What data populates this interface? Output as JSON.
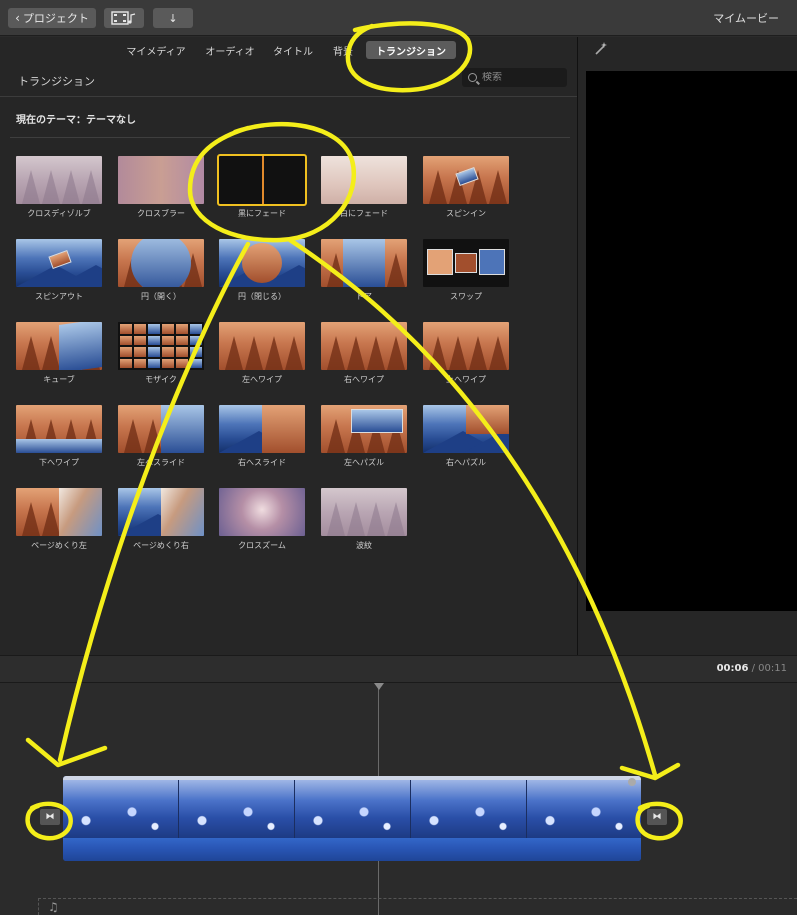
{
  "toolbar": {
    "back_label": "プロジェクト",
    "back_chevron": "‹",
    "media_icon": "film-music-icon",
    "import_icon": "download-arrow-icon",
    "import_glyph": "↓",
    "project_title": "マイムービー"
  },
  "browser": {
    "tabs": [
      {
        "label": "マイメディア",
        "active": false
      },
      {
        "label": "オーディオ",
        "active": false
      },
      {
        "label": "タイトル",
        "active": false
      },
      {
        "label": "背景",
        "active": false
      },
      {
        "label": "トランジション",
        "active": true
      }
    ],
    "panel_title": "トランジション",
    "search_placeholder": "検索",
    "theme_label": "現在のテーマ：テーマなし",
    "transitions": [
      {
        "label": "クロスディゾルブ",
        "style": "pale"
      },
      {
        "label": "クロスブラー",
        "style": "blur"
      },
      {
        "label": "黒にフェード",
        "style": "dark",
        "selected": true
      },
      {
        "label": "白にフェード",
        "style": "lightfade"
      },
      {
        "label": "スピンイン",
        "style": "forest"
      },
      {
        "label": "スピンアウト",
        "style": "mountain"
      },
      {
        "label": "円（開く）",
        "style": "forest"
      },
      {
        "label": "円（閉じる）",
        "style": "mountain"
      },
      {
        "label": "ドア",
        "style": "forest"
      },
      {
        "label": "スワップ",
        "style": "dark"
      },
      {
        "label": "キューブ",
        "style": "forest"
      },
      {
        "label": "モザイク",
        "style": "dark"
      },
      {
        "label": "左へワイプ",
        "style": "forest"
      },
      {
        "label": "右へワイプ",
        "style": "forest"
      },
      {
        "label": "上へワイプ",
        "style": "forest"
      },
      {
        "label": "下へワイプ",
        "style": "forest"
      },
      {
        "label": "左へスライド",
        "style": "forest"
      },
      {
        "label": "右へスライド",
        "style": "mountain"
      },
      {
        "label": "左へパズル",
        "style": "forest"
      },
      {
        "label": "右へパズル",
        "style": "mountain"
      },
      {
        "label": "ページめくり左",
        "style": "forest"
      },
      {
        "label": "ページめくり右",
        "style": "mountain"
      },
      {
        "label": "クロスズーム",
        "style": "zoom"
      },
      {
        "label": "波紋",
        "style": "pale"
      }
    ]
  },
  "viewer": {
    "wand_icon": "magic-wand-icon"
  },
  "timeline": {
    "current_time": "00:06",
    "separator": "/",
    "total_time": "00:11",
    "transition_icon": "transition-bowtie-icon",
    "transition_glyph": "⧓",
    "music_icon": "music-note-icon",
    "music_glyph": "♫"
  },
  "annotation_color": "#f4ee1a"
}
